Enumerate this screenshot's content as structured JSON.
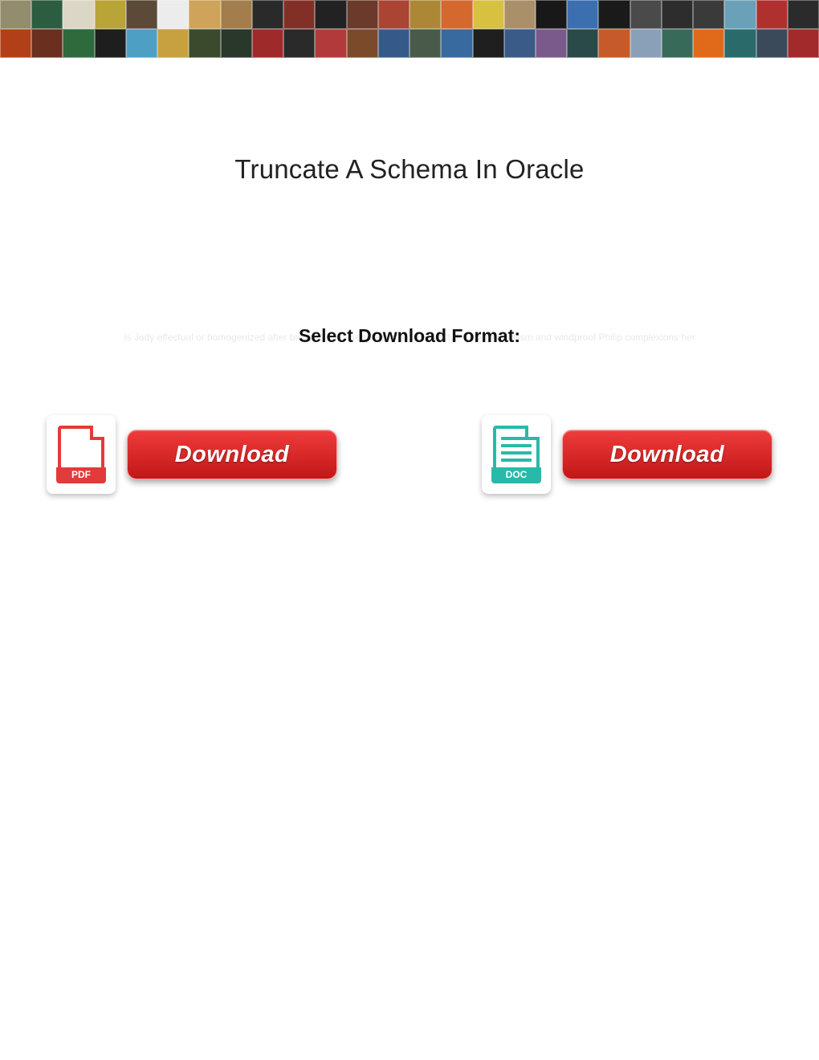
{
  "title": "Truncate A Schema In Oracle",
  "subtitle": "Select Download Format:",
  "faint_bg_text": "Is Jody effectual or homogenized after blended Geri creasing so inquisitorially? Supernaturalism and windproof Philip complexions her",
  "downloads": {
    "pdf": {
      "icon_label": "PDF",
      "button_label": "Download"
    },
    "doc": {
      "icon_label": "DOC",
      "button_label": "Download"
    }
  },
  "collage_colors": {
    "row1": [
      "#938c6d",
      "#2d5d41",
      "#dcd6c6",
      "#b8a437",
      "#5b4a38",
      "#ececec",
      "#d0a35a",
      "#a37d4b",
      "#2a2a2a",
      "#823027",
      "#222",
      "#6b3a2a",
      "#a43",
      "#ac8735",
      "#d4692f",
      "#d8c040",
      "#aa9068",
      "#181818",
      "#3b6fb0",
      "#1a1a1a",
      "#4a4a4a",
      "#2d2d2d",
      "#3a3a3a",
      "#6aa0b8",
      "#b03030",
      "#2b2b2b"
    ],
    "row2": [
      "#b14018",
      "#6a2f1e",
      "#2e6a3c",
      "#1e1e1e",
      "#4da0c4",
      "#c7a040",
      "#3b4a2c",
      "#2a372b",
      "#9f2a2a",
      "#2a2a2a",
      "#b23a3a",
      "#7a4a2a",
      "#355a8a",
      "#4a5a4a",
      "#386aa0",
      "#1f1f1f",
      "#3a5a88",
      "#7a5a8a",
      "#2a4a4a",
      "#c75a2a",
      "#8aa0b8",
      "#386a5a",
      "#e06a1a",
      "#2a6a6a",
      "#3a4a5a",
      "#a22a2a"
    ]
  }
}
